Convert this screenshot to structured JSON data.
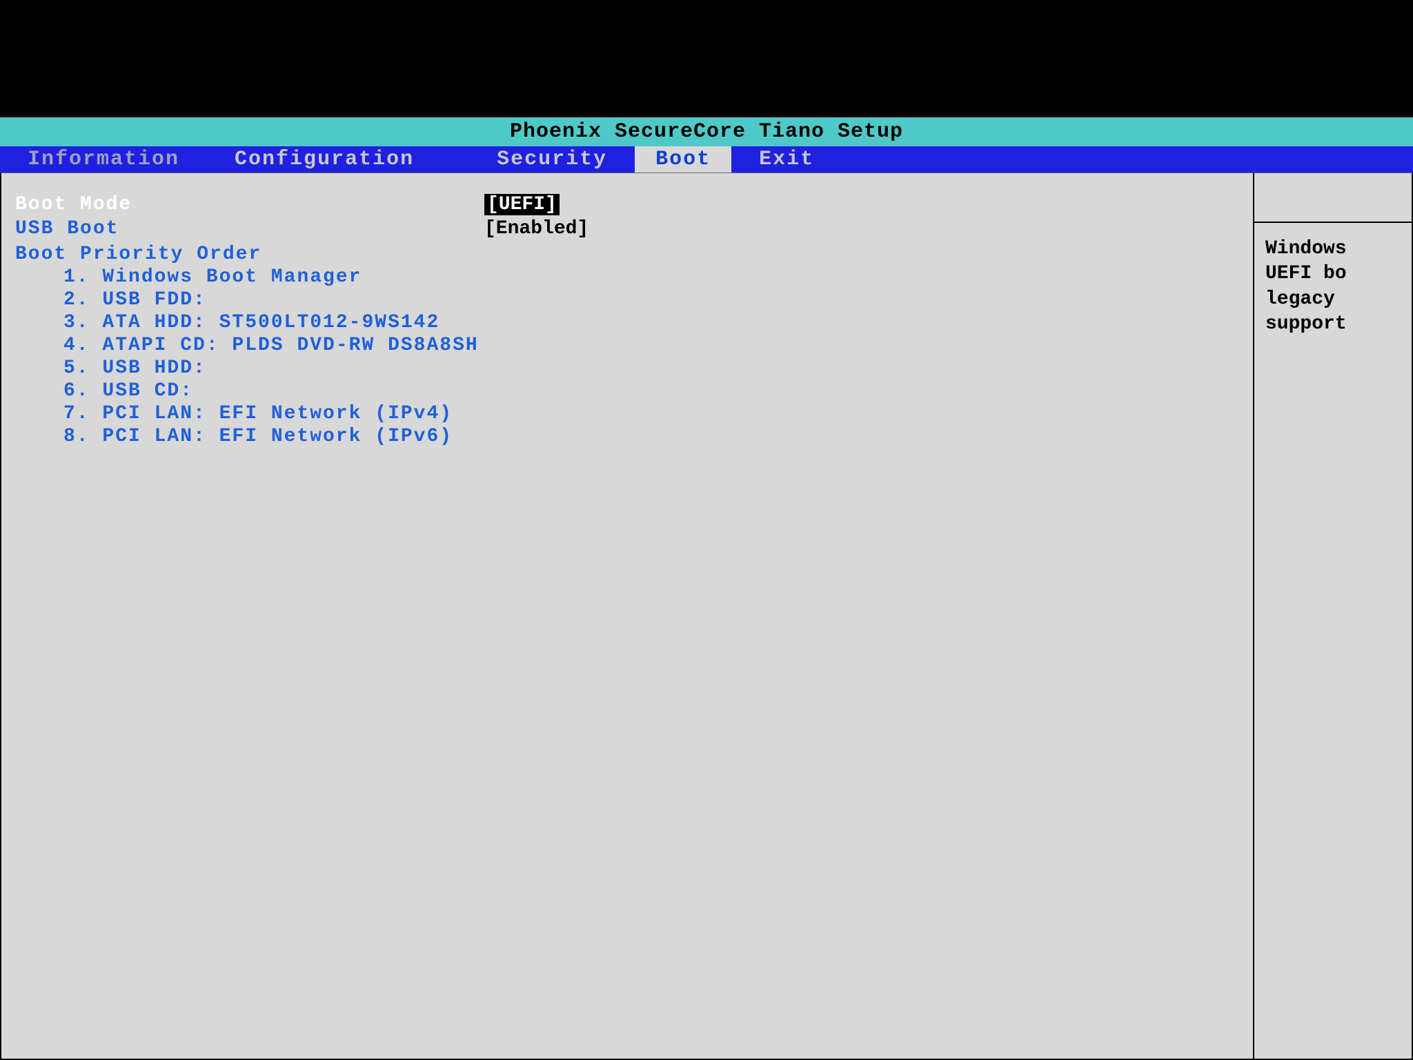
{
  "title": "Phoenix SecureCore Tiano Setup",
  "tabs": {
    "information": "Information",
    "configuration": "Configuration",
    "security": "Security",
    "boot": "Boot",
    "exit": "Exit"
  },
  "main": {
    "boot_mode": {
      "label": "Boot Mode",
      "value": "[UEFI]"
    },
    "usb_boot": {
      "label": "USB Boot",
      "value": "[Enabled]"
    },
    "priority_heading": "Boot Priority Order",
    "priority": [
      "1. Windows Boot Manager",
      "2. USB FDD:",
      "3. ATA HDD: ST500LT012-9WS142",
      "4. ATAPI CD: PLDS DVD-RW DS8A8SH",
      "5. USB HDD:",
      "6. USB CD:",
      "7. PCI LAN: EFI Network (IPv4)",
      "8. PCI LAN: EFI Network (IPv6)"
    ]
  },
  "help": {
    "line1": "Windows",
    "line2": "UEFI bo",
    "line3": "legacy",
    "line4": "support"
  },
  "colors": {
    "titlebar_bg": "#4fc8c8",
    "tab_bg": "#2020e0",
    "panel_bg": "#d8d8d8",
    "label_blue": "#2060d8"
  }
}
